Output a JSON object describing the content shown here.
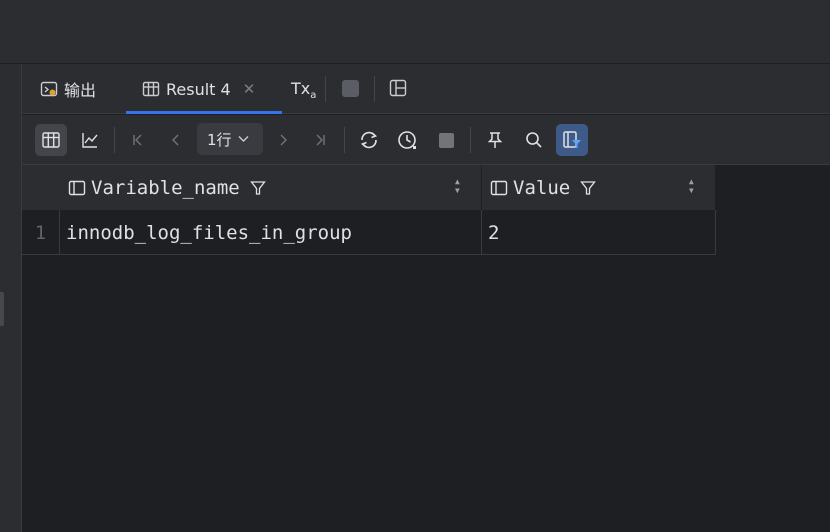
{
  "tabs": {
    "output_label": "输出",
    "result_label": "Result 4",
    "tx_label": "Tx",
    "tx_sub": "a"
  },
  "toolbar": {
    "page_value": "1行"
  },
  "table": {
    "columns": [
      "Variable_name",
      "Value"
    ],
    "rows": [
      {
        "num": "1",
        "cells": [
          "innodb_log_files_in_group",
          "2"
        ]
      }
    ]
  },
  "colors": {
    "accent": "#3574f0",
    "background": "#1e1f22",
    "panel": "#2b2d30"
  }
}
